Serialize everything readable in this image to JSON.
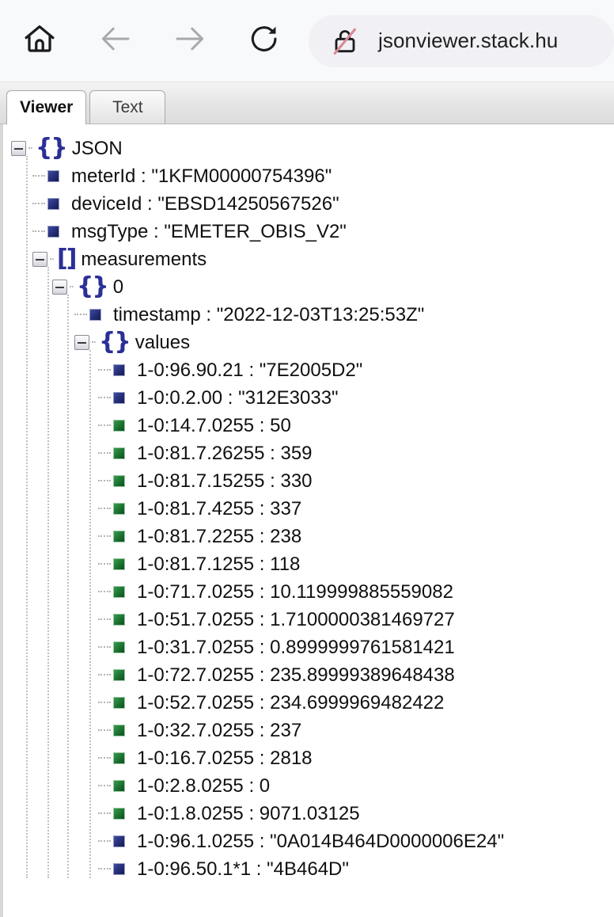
{
  "browser": {
    "home_label": "Home",
    "back_label": "Back",
    "forward_label": "Forward",
    "reload_label": "Reload",
    "url": "jsonviewer.stack.hu",
    "security_state": "not-secure",
    "icons": {
      "home": "home-icon",
      "back": "arrow-left-icon",
      "forward": "arrow-right-icon",
      "reload": "reload-icon",
      "security": "lock-slashed-icon"
    },
    "colors": {
      "toolbar_bg": "#f8f9fb",
      "omnibox_bg": "#f1f0f4",
      "slash": "#d88a96",
      "icon_active": "#1c1c1e",
      "icon_disabled": "#a8a9ad"
    }
  },
  "tabs": [
    {
      "label": "Viewer",
      "active": true
    },
    {
      "label": "Text",
      "active": false
    }
  ],
  "tree": {
    "colors": {
      "string_node": "#232b78",
      "number_node": "#1c7a33",
      "brace": "#2b2f96",
      "guide": "#c0c0c0"
    },
    "rows": [
      {
        "depth": 0,
        "kind": "object",
        "toggle": true,
        "glyph": "{}",
        "text": "JSON"
      },
      {
        "depth": 1,
        "kind": "string",
        "toggle": false,
        "glyph": "",
        "text": "meterId : \"1KFM00000754396\""
      },
      {
        "depth": 1,
        "kind": "string",
        "toggle": false,
        "glyph": "",
        "text": "deviceId : \"EBSD14250567526\""
      },
      {
        "depth": 1,
        "kind": "string",
        "toggle": false,
        "glyph": "",
        "text": "msgType : \"EMETER_OBIS_V2\""
      },
      {
        "depth": 1,
        "kind": "array",
        "toggle": true,
        "glyph": "[]",
        "text": "measurements"
      },
      {
        "depth": 2,
        "kind": "object",
        "toggle": true,
        "glyph": "{}",
        "text": "0"
      },
      {
        "depth": 3,
        "kind": "string",
        "toggle": false,
        "glyph": "",
        "text": "timestamp : \"2022-12-03T13:25:53Z\""
      },
      {
        "depth": 3,
        "kind": "object",
        "toggle": true,
        "glyph": "{}",
        "text": "values"
      },
      {
        "depth": 4,
        "kind": "string",
        "toggle": false,
        "glyph": "",
        "text": "1-0:96.90.21 : \"7E2005D2\""
      },
      {
        "depth": 4,
        "kind": "string",
        "toggle": false,
        "glyph": "",
        "text": "1-0:0.2.00 : \"312E3033\""
      },
      {
        "depth": 4,
        "kind": "number",
        "toggle": false,
        "glyph": "",
        "text": "1-0:14.7.0255 : 50"
      },
      {
        "depth": 4,
        "kind": "number",
        "toggle": false,
        "glyph": "",
        "text": "1-0:81.7.26255 : 359"
      },
      {
        "depth": 4,
        "kind": "number",
        "toggle": false,
        "glyph": "",
        "text": "1-0:81.7.15255 : 330"
      },
      {
        "depth": 4,
        "kind": "number",
        "toggle": false,
        "glyph": "",
        "text": "1-0:81.7.4255 : 337"
      },
      {
        "depth": 4,
        "kind": "number",
        "toggle": false,
        "glyph": "",
        "text": "1-0:81.7.2255 : 238"
      },
      {
        "depth": 4,
        "kind": "number",
        "toggle": false,
        "glyph": "",
        "text": "1-0:81.7.1255 : 118"
      },
      {
        "depth": 4,
        "kind": "number",
        "toggle": false,
        "glyph": "",
        "text": "1-0:71.7.0255 : 10.119999885559082"
      },
      {
        "depth": 4,
        "kind": "number",
        "toggle": false,
        "glyph": "",
        "text": "1-0:51.7.0255 : 1.7100000381469727"
      },
      {
        "depth": 4,
        "kind": "number",
        "toggle": false,
        "glyph": "",
        "text": "1-0:31.7.0255 : 0.8999999761581421"
      },
      {
        "depth": 4,
        "kind": "number",
        "toggle": false,
        "glyph": "",
        "text": "1-0:72.7.0255 : 235.89999389648438"
      },
      {
        "depth": 4,
        "kind": "number",
        "toggle": false,
        "glyph": "",
        "text": "1-0:52.7.0255 : 234.6999969482422"
      },
      {
        "depth": 4,
        "kind": "number",
        "toggle": false,
        "glyph": "",
        "text": "1-0:32.7.0255 : 237"
      },
      {
        "depth": 4,
        "kind": "number",
        "toggle": false,
        "glyph": "",
        "text": "1-0:16.7.0255 : 2818"
      },
      {
        "depth": 4,
        "kind": "number",
        "toggle": false,
        "glyph": "",
        "text": "1-0:2.8.0255 : 0"
      },
      {
        "depth": 4,
        "kind": "number",
        "toggle": false,
        "glyph": "",
        "text": "1-0:1.8.0255 : 9071.03125"
      },
      {
        "depth": 4,
        "kind": "string",
        "toggle": false,
        "glyph": "",
        "text": "1-0:96.1.0255 : \"0A014B464D0000006E24\""
      },
      {
        "depth": 4,
        "kind": "string",
        "toggle": false,
        "glyph": "",
        "text": "1-0:96.50.1*1 : \"4B464D\""
      }
    ]
  }
}
